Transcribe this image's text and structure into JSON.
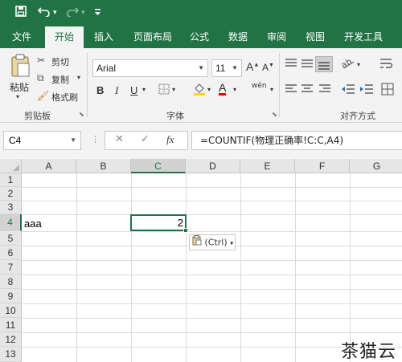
{
  "quick_access": {
    "save_icon": "save-icon",
    "undo_icon": "undo-icon",
    "redo_icon": "redo-icon",
    "customize_icon": "customize-icon"
  },
  "tabs": [
    "文件",
    "开始",
    "插入",
    "页面布局",
    "公式",
    "数据",
    "审阅",
    "视图",
    "开发工具"
  ],
  "active_tab": "开始",
  "ribbon": {
    "paste_label": "粘贴",
    "cut_label": "剪切",
    "copy_label": "复制",
    "format_painter_label": "格式刷",
    "clipboard_group": "剪贴板",
    "font_name": "Arial",
    "font_size": "11",
    "font_group": "字体",
    "alignment_group": "对齐方式",
    "bold": "B",
    "italic": "I",
    "underline": "U",
    "wen": "wén",
    "grow_font": "A",
    "shrink_font": "A"
  },
  "formula_bar": {
    "name_box": "C4",
    "cancel": "✕",
    "enter": "✓",
    "fx": "fx",
    "formula": "=COUNTIF(物理正确率!C:C,A4)"
  },
  "sheet": {
    "columns": [
      "A",
      "B",
      "C",
      "D",
      "E",
      "F",
      "G"
    ],
    "selected_column": "C",
    "rows": [
      "1",
      "2",
      "3",
      "4",
      "5",
      "6",
      "7",
      "8",
      "9",
      "10",
      "11",
      "12",
      "13"
    ],
    "selected_row": "4",
    "cells": {
      "A4": "aaa",
      "C4": "2"
    }
  },
  "paste_options": "(Ctrl)",
  "watermark": "茶猫云",
  "colors": {
    "accent": "#217346",
    "ribbon_bg": "#f3f3f3"
  }
}
